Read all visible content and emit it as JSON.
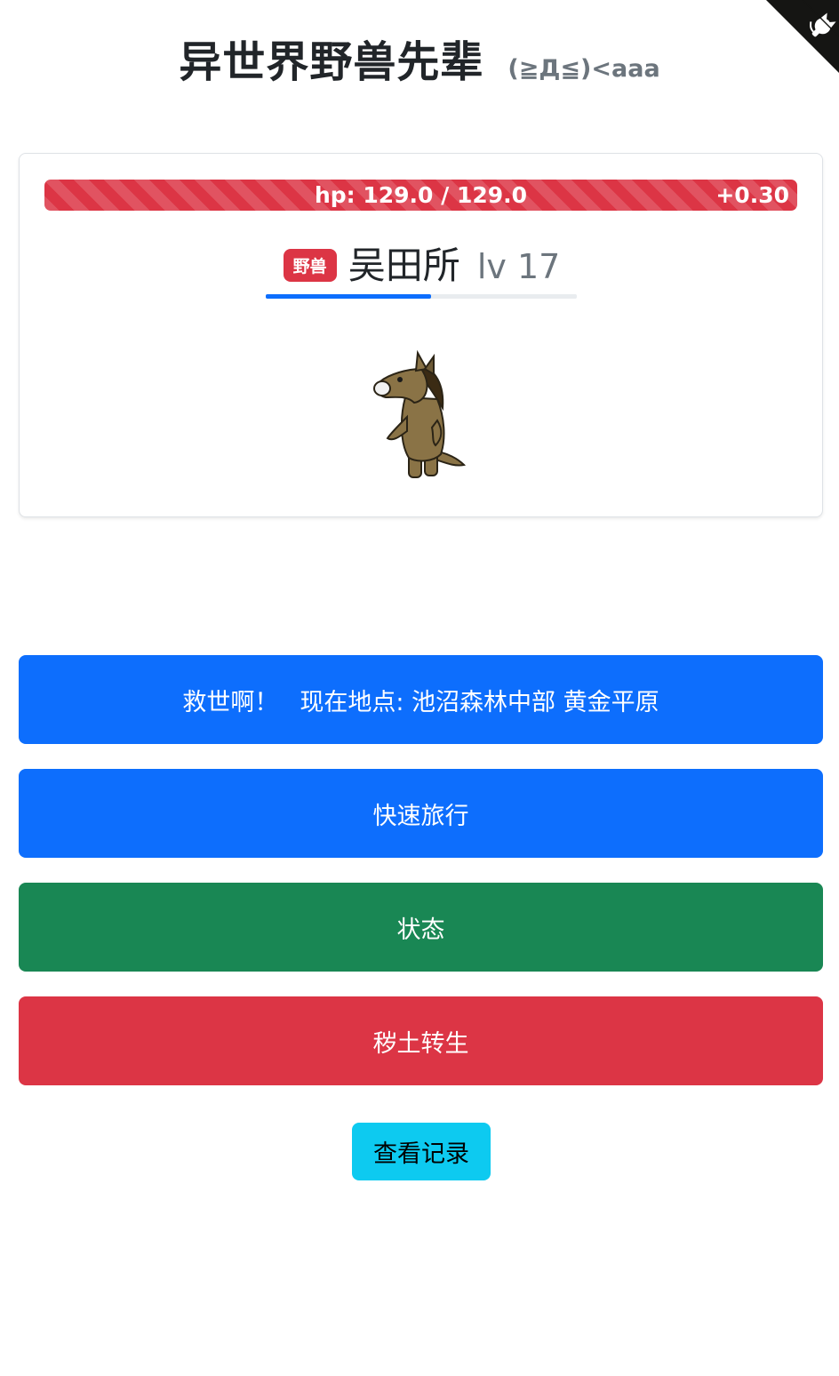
{
  "header": {
    "title": "异世界野兽先辈",
    "subtitle": "(≧Д≦)<aaa"
  },
  "corner": {
    "icon": "github-cat-icon"
  },
  "monster": {
    "hp_text": "hp: 129.0 / 129.0",
    "hp_regen": "+0.30",
    "hp_fraction": 1.0,
    "badge": "野兽",
    "name": "吴田所",
    "level": "lv 17",
    "xp_fraction": 0.53,
    "image": "horse-creature"
  },
  "buttons": {
    "save_label": "救世啊！",
    "location_label": "现在地点: 池沼森林中部 黄金平原",
    "travel_label": "快速旅行",
    "status_label": "状态",
    "reincarnate_label": "秽土转生",
    "log_label": "查看记录"
  },
  "colors": {
    "primary": "#0d6efd",
    "success": "#198754",
    "danger": "#dc3545",
    "info": "#0dcaf0"
  }
}
